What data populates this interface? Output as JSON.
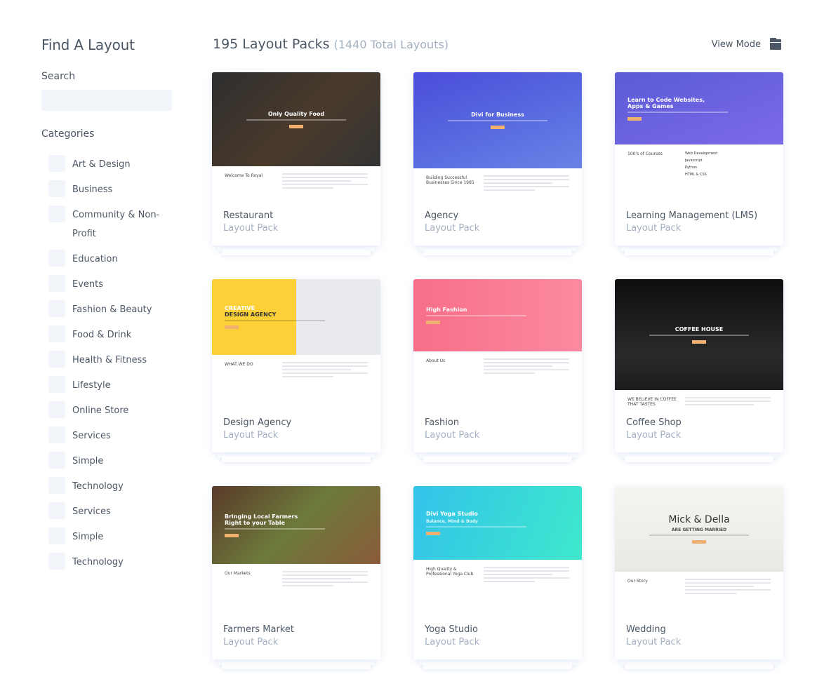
{
  "sidebar": {
    "title": "Find A Layout",
    "search_label": "Search",
    "search_value": "",
    "categories_label": "Categories",
    "categories": [
      "Art & Design",
      "Business",
      "Community & Non-Profit",
      "Education",
      "Events",
      "Fashion & Beauty",
      "Food & Drink",
      "Health & Fitness",
      "Lifestyle",
      "Online Store",
      "Services",
      "Simple",
      "Technology",
      "Services",
      "Simple",
      "Technology"
    ]
  },
  "header": {
    "count": "195 Layout Packs",
    "total": "(1440 Total Layouts)",
    "view_mode": "View Mode",
    "view_mode_icon": "folder-icon"
  },
  "cards": [
    {
      "name": "Restaurant",
      "sub": "Layout Pack",
      "hero_title": "Only Quality Food",
      "low_title": "Welcome To Royal",
      "hero_bg": "linear-gradient(135deg,#2e2e2e,#4a3a2c 55%,#333)",
      "hero_h": 134,
      "center": true
    },
    {
      "name": "Agency",
      "sub": "Layout Pack",
      "hero_title": "Divi for Business",
      "low_title": "Building Successful Businesses Since 1985",
      "hero_bg": "linear-gradient(160deg,#4a4ddb,#5a6ee0 60%,#6a82e6)",
      "hero_h": 137,
      "center": true
    },
    {
      "name": "Learning Management (LMS)",
      "sub": "Layout Pack",
      "hero_title": "Learn to Code Websites, Apps & Games",
      "low_title": "100's of Courses",
      "features": [
        "Web Development",
        "Javascript",
        "Python",
        "HTML & CSS"
      ],
      "hero_bg": "linear-gradient(160deg,#5b5bd6,#7c6ae8)",
      "hero_h": 103
    },
    {
      "name": "Design Agency",
      "sub": "Layout Pack",
      "hero_kicker": "CREATIVE",
      "hero_title": "DESIGN AGENCY",
      "low_title": "WHAT WE DO",
      "hero_bg": "linear-gradient(90deg,#fcd037 50%,#e8eaee 50%)",
      "hero_h": 108,
      "dark": true
    },
    {
      "name": "Fashion",
      "sub": "Layout Pack",
      "hero_title": "High Fashion",
      "low_title": "About Us",
      "hero_bg": "linear-gradient(90deg,#f76e8a,#fb8aa0)",
      "hero_h": 103
    },
    {
      "name": "Coffee Shop",
      "sub": "Layout Pack",
      "hero_title": "COFFEE HOUSE",
      "low_title": "WE BELIEVE IN COFFEE THAT TASTES",
      "hero_bg": "linear-gradient(180deg,#0e0e0e,#2a2a2a 70%,#1c1c1c)",
      "hero_h": 158,
      "center": true
    },
    {
      "name": "Farmers Market",
      "sub": "Layout Pack",
      "hero_title": "Bringing Local Farmers Right to your Table",
      "low_title": "Our Markets",
      "hero_bg": "linear-gradient(135deg,#5a3a2a,#6c7a3a 50%,#8a5a3a)",
      "hero_h": 111
    },
    {
      "name": "Yoga Studio",
      "sub": "Layout Pack",
      "hero_title": "Divi Yoga Studio",
      "hero_kicker2": "Balance, Mind & Body",
      "low_title": "High Quality & Professional Yoga Club",
      "hero_bg": "linear-gradient(110deg,#33c3ea,#3ee8cc)",
      "hero_h": 105
    },
    {
      "name": "Wedding",
      "sub": "Layout Pack",
      "hero_title": "Mick & Della",
      "hero_kicker2": "ARE GETTING MARRIED",
      "low_title": "Our Story",
      "hero_bg": "linear-gradient(180deg,#f4f4f2,#e9e9e4)",
      "hero_h": 122,
      "center": true,
      "dark": true
    }
  ],
  "colors": {
    "text": "#4c5866",
    "muted": "#a3b0c2",
    "input_bg": "#f1f4f9"
  }
}
